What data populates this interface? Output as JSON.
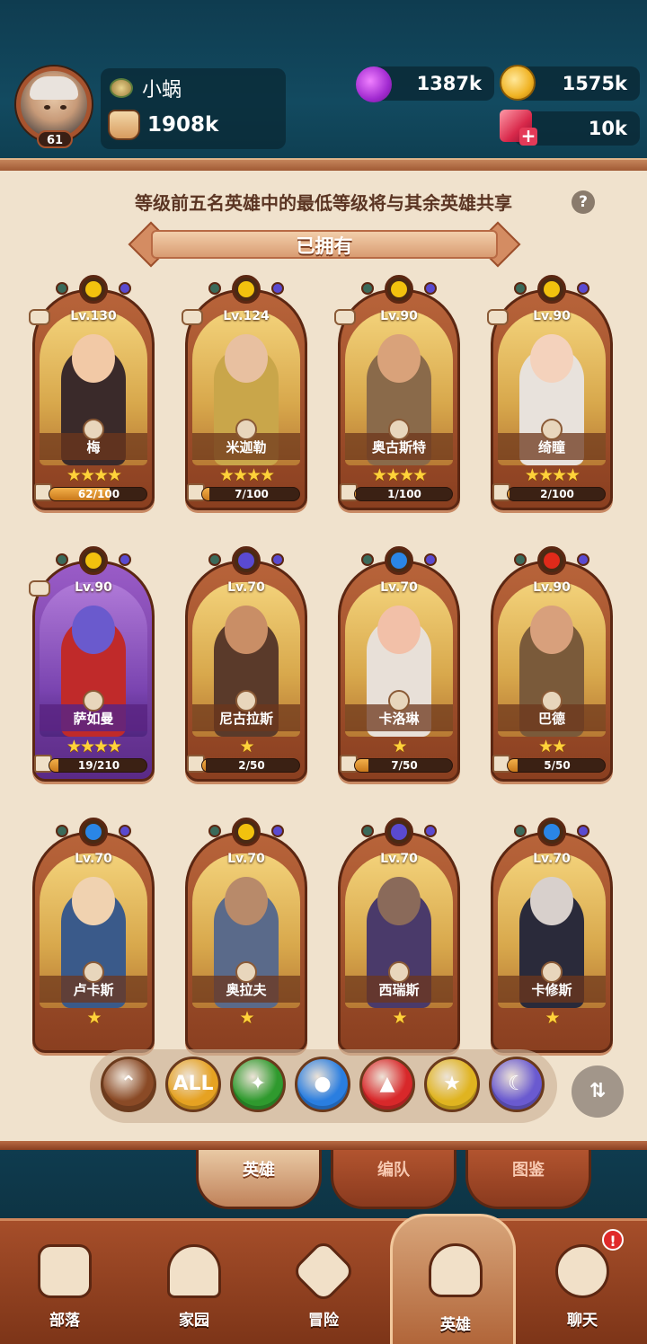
{
  "player": {
    "name": "小蜗",
    "level": "61",
    "power": "1908k"
  },
  "resources": {
    "potion": "1387k",
    "gold": "1575k",
    "gems": "10k"
  },
  "notice": "等级前五名英雄中的最低等级将与其余英雄共享",
  "section_title": "已拥有",
  "heroes": [
    {
      "name": "梅",
      "level": "Lv.130",
      "stars": "★★★★",
      "progress": "62/100",
      "progress_fraction": 0.62,
      "element": "light",
      "team": true
    },
    {
      "name": "米迦勒",
      "level": "Lv.124",
      "stars": "★★★★",
      "progress": "7/100",
      "progress_fraction": 0.07,
      "element": "light",
      "team": true
    },
    {
      "name": "奥古斯特",
      "level": "Lv.90",
      "stars": "★★★★",
      "progress": "1/100",
      "progress_fraction": 0.01,
      "element": "light",
      "team": true
    },
    {
      "name": "绮瞳",
      "level": "Lv.90",
      "stars": "★★★★",
      "progress": "2/100",
      "progress_fraction": 0.02,
      "element": "light",
      "team": true
    },
    {
      "name": "萨如曼",
      "level": "Lv.90",
      "stars": "★★★★",
      "progress": "19/210",
      "progress_fraction": 0.09,
      "element": "light",
      "team": true,
      "rarity": "purple"
    },
    {
      "name": "尼古拉斯",
      "level": "Lv.70",
      "stars": "★",
      "progress": "2/50",
      "progress_fraction": 0.04,
      "element": "dark",
      "team": false
    },
    {
      "name": "卡洛琳",
      "level": "Lv.70",
      "stars": "★",
      "progress": "7/50",
      "progress_fraction": 0.14,
      "element": "water",
      "team": false
    },
    {
      "name": "巴德",
      "level": "Lv.90",
      "stars": "★★",
      "progress": "5/50",
      "progress_fraction": 0.1,
      "element": "fire",
      "team": false
    },
    {
      "name": "卢卡斯",
      "level": "Lv.70",
      "stars": "★",
      "element": "water",
      "team": false
    },
    {
      "name": "奥拉夫",
      "level": "Lv.70",
      "stars": "★",
      "element": "light",
      "team": false
    },
    {
      "name": "西瑞斯",
      "level": "Lv.70",
      "stars": "★",
      "element": "dark",
      "team": false
    },
    {
      "name": "卡修斯",
      "level": "Lv.70",
      "stars": "★",
      "element": "water",
      "team": false
    }
  ],
  "filters": [
    {
      "name": "sort-up-icon",
      "label": "",
      "color": "#8a4a26"
    },
    {
      "name": "all-filter",
      "label": "ALL",
      "color": "#e6a222"
    },
    {
      "name": "nature-icon",
      "label": "",
      "color": "#2f9a2e"
    },
    {
      "name": "water-icon",
      "label": "",
      "color": "#2a7ee0"
    },
    {
      "name": "fire-icon",
      "label": "",
      "color": "#d8282a"
    },
    {
      "name": "light-icon",
      "label": "",
      "color": "#e0b420"
    },
    {
      "name": "dark-icon",
      "label": "",
      "color": "#6a5ad0"
    }
  ],
  "tabs": [
    "英雄",
    "编队",
    "图鉴"
  ],
  "nav": [
    "部落",
    "家园",
    "冒险",
    "英雄",
    "聊天"
  ],
  "notification_badge": "!",
  "colors": {
    "light": "#f2c20e",
    "dark": "#5a4ad0",
    "water": "#2a86e6",
    "fire": "#e02a1a",
    "nature": "#2f9a2e"
  }
}
